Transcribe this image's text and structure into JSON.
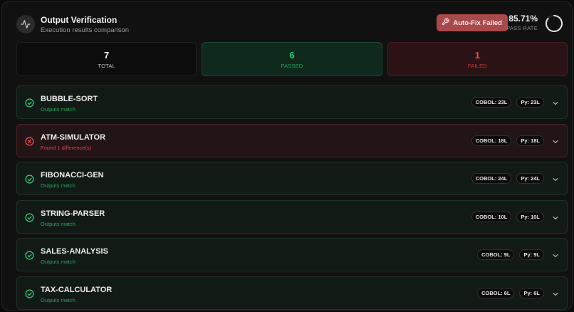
{
  "header": {
    "title": "Output Verification",
    "subtitle": "Execution results comparison",
    "autofix_label": "Auto-Fix Failed",
    "pass_rate": "85.71%",
    "pass_rate_label": "PASS RATE",
    "pass_rate_fraction": 0.8571
  },
  "stats": {
    "total": {
      "value": "7",
      "label": "TOTAL"
    },
    "passed": {
      "value": "6",
      "label": "PASSED"
    },
    "failed": {
      "value": "1",
      "label": "FAILED"
    }
  },
  "colors": {
    "pass": "#2fcf71",
    "fail": "#f0484f",
    "autofix_button": "#a8494b"
  },
  "icons": {
    "header": "activity-icon",
    "autofix": "wrench-icon",
    "pass": "check-circle-icon",
    "fail": "x-circle-icon",
    "expand": "chevron-down-icon"
  },
  "items": [
    {
      "name": "BUBBLE-SORT",
      "status": "pass",
      "message": "Outputs match",
      "cobol": "COBOL: 23L",
      "py": "Py: 23L"
    },
    {
      "name": "ATM-SIMULATOR",
      "status": "fail",
      "message": "Found 1 difference(s)",
      "cobol": "COBOL: 18L",
      "py": "Py: 18L"
    },
    {
      "name": "FIBONACCI-GEN",
      "status": "pass",
      "message": "Outputs match",
      "cobol": "COBOL: 24L",
      "py": "Py: 24L"
    },
    {
      "name": "STRING-PARSER",
      "status": "pass",
      "message": "Outputs match",
      "cobol": "COBOL: 10L",
      "py": "Py: 10L"
    },
    {
      "name": "SALES-ANALYSIS",
      "status": "pass",
      "message": "Outputs match",
      "cobol": "COBOL: 9L",
      "py": "Py: 9L"
    },
    {
      "name": "TAX-CALCULATOR",
      "status": "pass",
      "message": "Outputs match",
      "cobol": "COBOL: 6L",
      "py": "Py: 6L"
    }
  ]
}
